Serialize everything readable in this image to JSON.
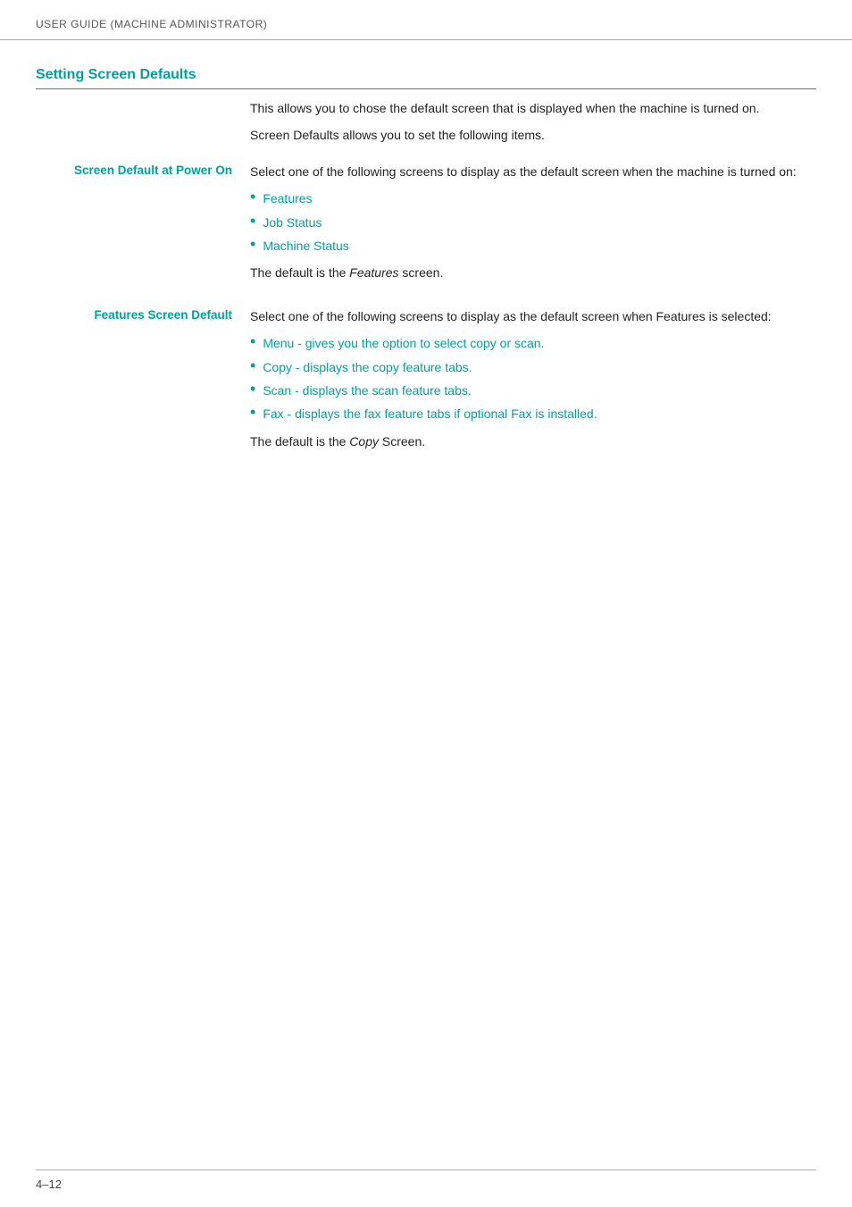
{
  "header": {
    "title": "User Guide (Machine Administrator)"
  },
  "section": {
    "title": "Setting Screen Defaults"
  },
  "intro": {
    "para1": "This allows you to chose the default screen that is displayed when the machine is turned on.",
    "para2": "Screen Defaults allows you to set the following items."
  },
  "entries": [
    {
      "id": "screen-default-power-on",
      "label": "Screen Default at Power On",
      "intro": "Select one of the following screens to display as the default screen when the machine is turned on:",
      "bullets": [
        {
          "text": "Features"
        },
        {
          "text": "Job Status"
        },
        {
          "text": "Machine Status"
        }
      ],
      "footer_text": "The default is the ",
      "footer_italic": "Features",
      "footer_text2": " screen."
    },
    {
      "id": "features-screen-default",
      "label": "Features Screen Default",
      "intro": "Select one of the following screens to display as the default screen when Features is selected:",
      "bullets": [
        {
          "text": "Menu - gives you the option to select copy or scan."
        },
        {
          "text": "Copy - displays the copy feature tabs."
        },
        {
          "text": "Scan - displays the scan feature tabs."
        },
        {
          "text": "Fax - displays the fax feature tabs if optional Fax is installed."
        }
      ],
      "footer_text": "The default is the ",
      "footer_italic": "Copy",
      "footer_text2": " Screen."
    }
  ],
  "footer": {
    "page_number": "4–12"
  }
}
